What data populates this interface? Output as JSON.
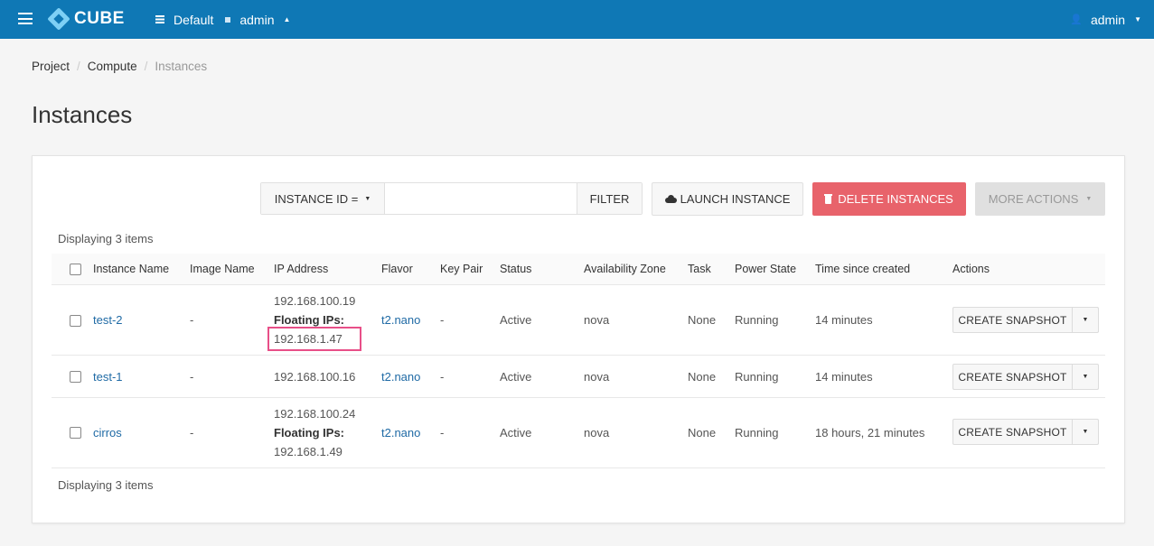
{
  "header": {
    "brand": "CUBE",
    "domain": "Default",
    "project": "admin",
    "user": "admin",
    "color": "#0f78b5"
  },
  "breadcrumb": [
    "Project",
    "Compute",
    "Instances"
  ],
  "page_title": "Instances",
  "toolbar": {
    "filter_field": "INSTANCE ID =",
    "filter_value": "",
    "filter_label": "FILTER",
    "launch_label": "LAUNCH INSTANCE",
    "delete_label": "DELETE INSTANCES",
    "more_label": "MORE ACTIONS"
  },
  "displaying_text": "Displaying 3 items",
  "table": {
    "columns": [
      "Instance Name",
      "Image Name",
      "IP Address",
      "Flavor",
      "Key Pair",
      "Status",
      "Availability Zone",
      "Task",
      "Power State",
      "Time since created",
      "Actions"
    ],
    "floating_label": "Floating IPs:",
    "action_label": "CREATE SNAPSHOT",
    "rows": [
      {
        "name": "test-2",
        "image": "-",
        "ip": "192.168.100.19",
        "floating": "192.168.1.47",
        "flavor": "t2.nano",
        "keypair": "-",
        "status": "Active",
        "zone": "nova",
        "task": "None",
        "power": "Running",
        "age": "14 minutes"
      },
      {
        "name": "test-1",
        "image": "-",
        "ip": "192.168.100.16",
        "floating": "",
        "flavor": "t2.nano",
        "keypair": "-",
        "status": "Active",
        "zone": "nova",
        "task": "None",
        "power": "Running",
        "age": "14 minutes"
      },
      {
        "name": "cirros",
        "image": "-",
        "ip": "192.168.100.24",
        "floating": "192.168.1.49",
        "flavor": "t2.nano",
        "keypair": "-",
        "status": "Active",
        "zone": "nova",
        "task": "None",
        "power": "Running",
        "age": "18 hours, 21 minutes"
      }
    ]
  }
}
